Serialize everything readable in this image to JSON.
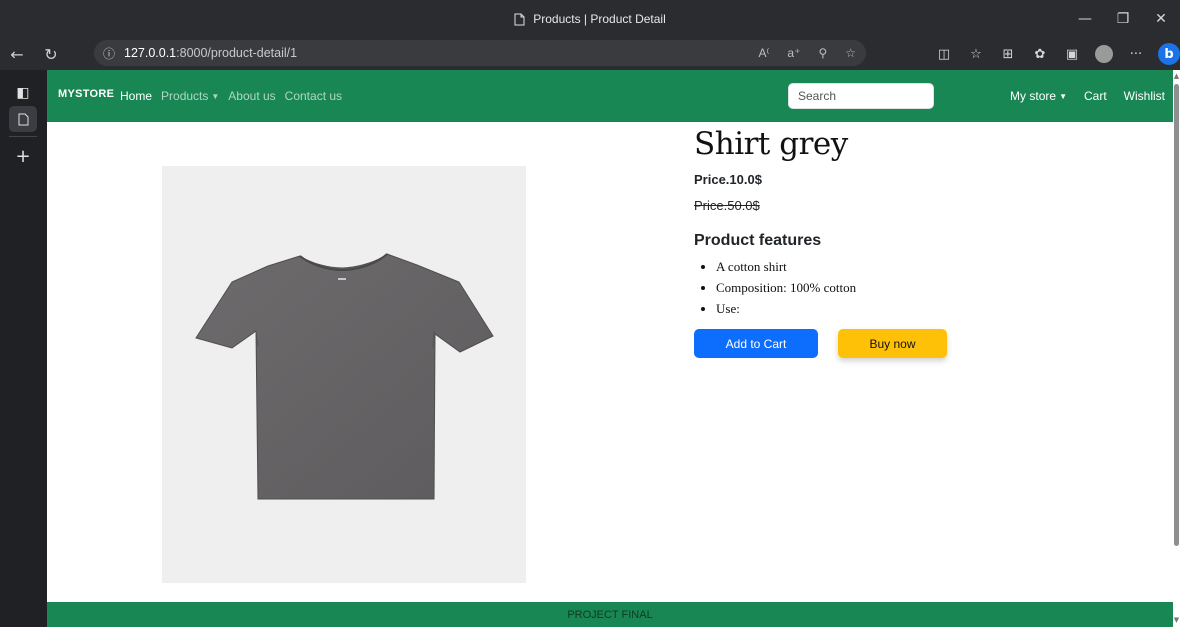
{
  "browser": {
    "window_title": "Products | Product Detail",
    "url_host": "127.0.0.1",
    "url_path": ":8000/product-detail/1",
    "icons": [
      "page-icon",
      "back-icon",
      "refresh-icon",
      "info-icon",
      "read-aloud-icon",
      "translate-icon",
      "zoom-icon",
      "favorite-icon",
      "split-screen-icon",
      "favorites-list-icon",
      "collections-icon",
      "extensions-icon",
      "screenshot-icon",
      "profile-avatar",
      "more-icon",
      "bing-icon"
    ],
    "more_label": "···"
  },
  "sidebar": {
    "icons": [
      "tab-actions-icon",
      "active-tab-icon",
      "new-tab-icon"
    ]
  },
  "site_nav": {
    "brand": "MYSTORE",
    "links": [
      "Home",
      "Products",
      "About us",
      "Contact us"
    ],
    "search_placeholder": "Search",
    "right_links": [
      "My store",
      "Cart",
      "Wishlist"
    ]
  },
  "product": {
    "name": "Shirt grey",
    "price": "Price.10.0$",
    "old_price": "Price.50.0$",
    "features_heading": "Product features",
    "features": [
      "A cotton shirt",
      "Composition: 100% cotton",
      "Use:"
    ],
    "add_to_cart": "Add to Cart",
    "buy_now": "Buy now"
  },
  "footer": {
    "text": "PROJECT FINAL"
  },
  "colors": {
    "nav_green": "#198754",
    "primary_blue": "#0d6efd",
    "warning_yellow": "#ffc107"
  }
}
